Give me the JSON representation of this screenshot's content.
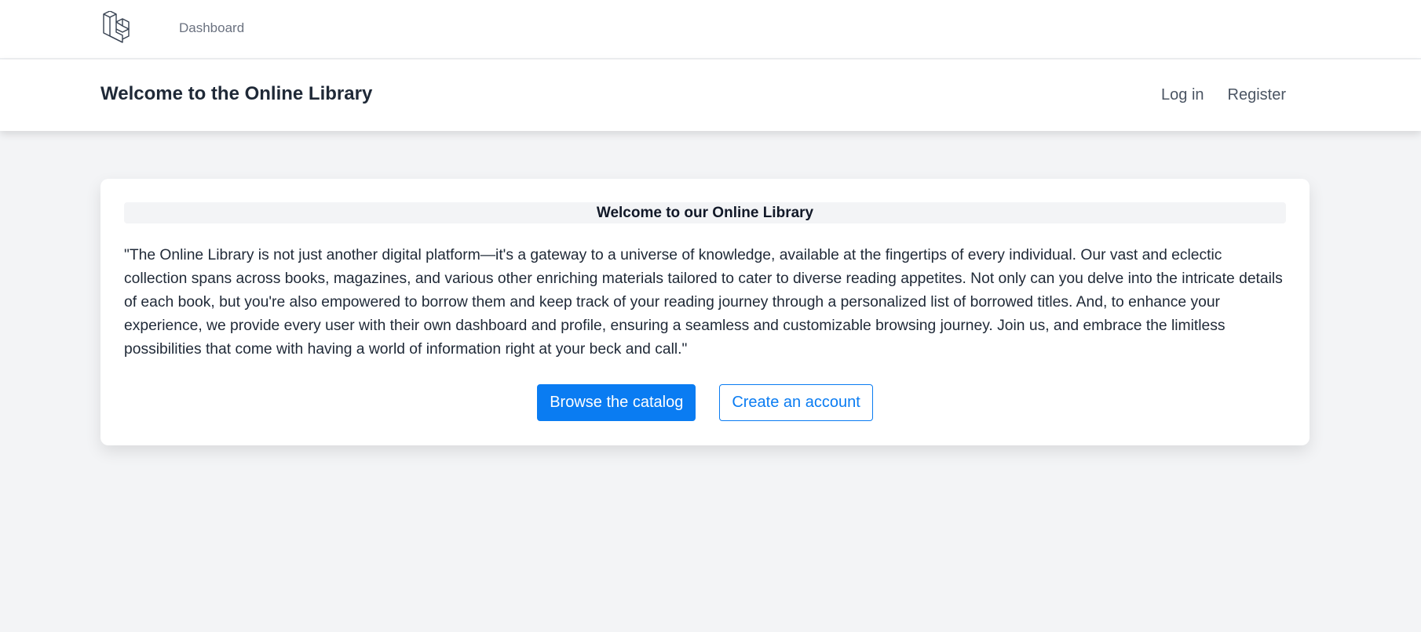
{
  "topnav": {
    "logo_icon": "laravel-logo-icon",
    "dashboard_link": "Dashboard"
  },
  "header": {
    "title": "Welcome to the Online Library",
    "login_link": "Log in",
    "register_link": "Register"
  },
  "card": {
    "title": "Welcome to our Online Library",
    "body": "\"The Online Library is not just another digital platform—it's a gateway to a universe of knowledge, available at the fingertips of every individual. Our vast and eclectic collection spans across books, magazines, and various other enriching materials tailored to cater to diverse reading appetites. Not only can you delve into the intricate details of each book, but you're also empowered to borrow them and keep track of your reading journey through a personalized list of borrowed titles. And, to enhance your experience, we provide every user with their own dashboard and profile, ensuring a seamless and customizable browsing journey. Join us, and embrace the limitless possibilities that come with having a world of information right at your beck and call.\"",
    "primary_button": "Browse the catalog",
    "secondary_button": "Create an account"
  },
  "colors": {
    "accent": "#0a7cf2",
    "background": "#f3f4f6",
    "surface": "#ffffff"
  }
}
